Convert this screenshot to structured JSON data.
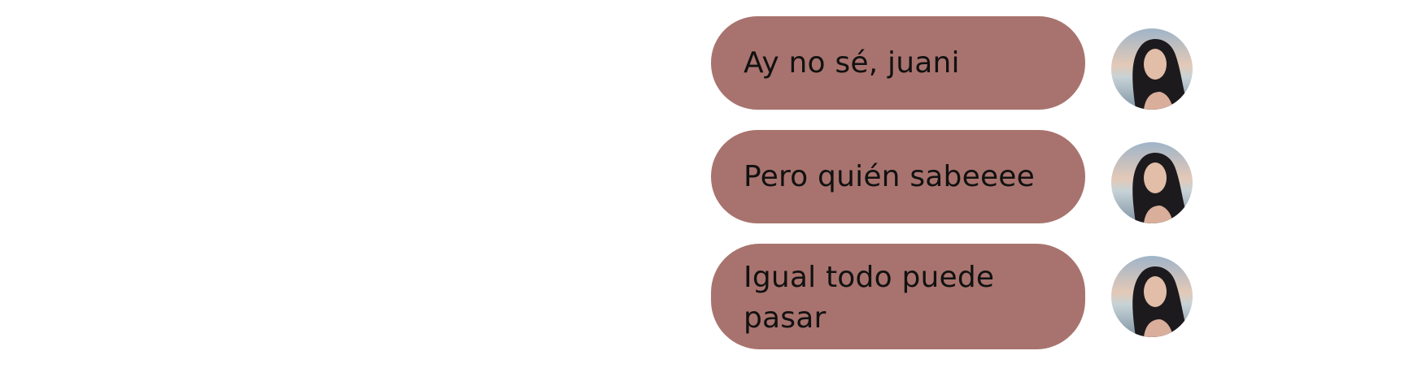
{
  "colors": {
    "background": "#ffffff",
    "bubble": "#a8736e",
    "text": "#111111"
  },
  "messages": [
    {
      "text": "Ay no sé, juani",
      "avatar_icon": "user-avatar-photo"
    },
    {
      "text": "Pero quién sabeeee",
      "avatar_icon": "user-avatar-photo"
    },
    {
      "text": "Igual todo puede pasar",
      "avatar_icon": "user-avatar-photo"
    }
  ]
}
